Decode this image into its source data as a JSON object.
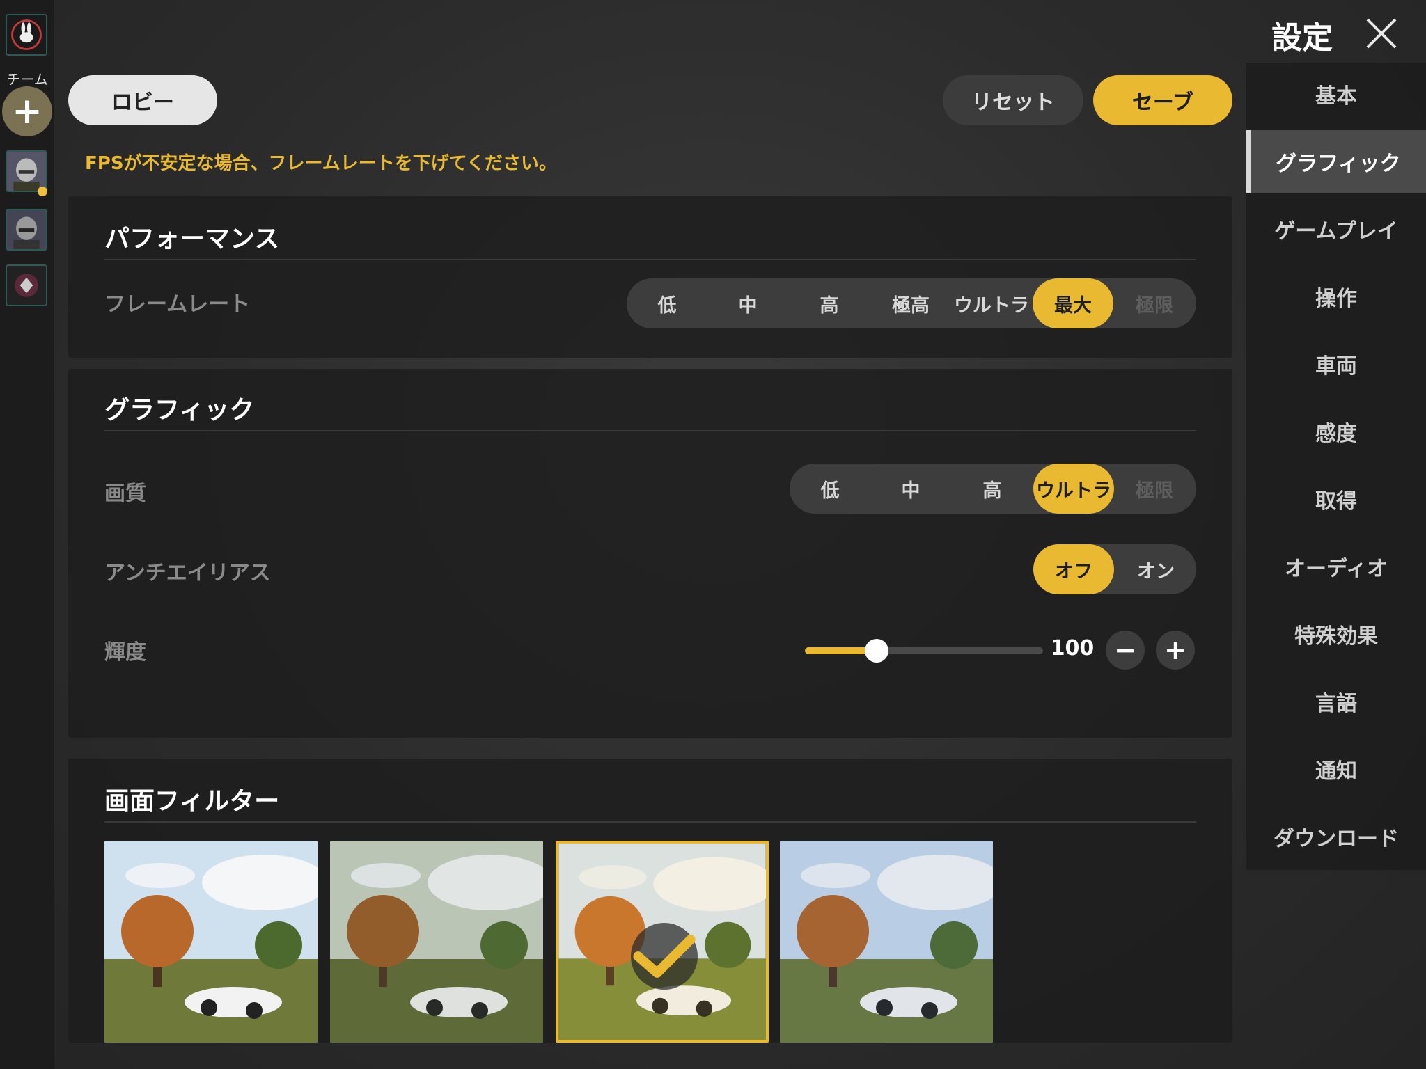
{
  "team": {
    "label": "チーム",
    "add_symbol": "+"
  },
  "toolbar": {
    "lobby_label": "ロビー",
    "reset_label": "リセット",
    "save_label": "セーブ"
  },
  "notice": "FPSが不安定な場合、フレームレートを下げてください。",
  "settings": {
    "title": "設定",
    "nav": [
      {
        "label": "基本",
        "active": false
      },
      {
        "label": "グラフィック",
        "active": true
      },
      {
        "label": "ゲームプレイ",
        "active": false
      },
      {
        "label": "操作",
        "active": false
      },
      {
        "label": "車両",
        "active": false
      },
      {
        "label": "感度",
        "active": false
      },
      {
        "label": "取得",
        "active": false
      },
      {
        "label": "オーディオ",
        "active": false
      },
      {
        "label": "特殊効果",
        "active": false
      },
      {
        "label": "言語",
        "active": false
      },
      {
        "label": "通知",
        "active": false
      },
      {
        "label": "ダウンロード",
        "active": false
      }
    ]
  },
  "performance": {
    "title": "パフォーマンス",
    "framerate": {
      "label": "フレームレート",
      "options": [
        "低",
        "中",
        "高",
        "極高",
        "ウルトラ",
        "最大",
        "極限"
      ],
      "selected": "最大",
      "disabled": [
        "極限"
      ]
    }
  },
  "graphics": {
    "title": "グラフィック",
    "quality": {
      "label": "画質",
      "options": [
        "低",
        "中",
        "高",
        "ウルトラ",
        "極限"
      ],
      "selected": "ウルトラ",
      "disabled": [
        "極限"
      ]
    },
    "antialias": {
      "label": "アンチエイリアス",
      "options": [
        "オフ",
        "オン"
      ],
      "selected": "オフ"
    },
    "brightness": {
      "label": "輝度",
      "value": "100",
      "level": 0.3,
      "minus": "−",
      "plus": "+"
    }
  },
  "filters": {
    "title": "画面フィルター",
    "count": 4,
    "selected_index": 2
  },
  "colors": {
    "accent": "#e8b931",
    "panel": "#1c1c1c",
    "background": "#2b2b2b"
  },
  "icons": [
    "close-icon",
    "check-icon",
    "plus-icon",
    "minus-icon"
  ]
}
